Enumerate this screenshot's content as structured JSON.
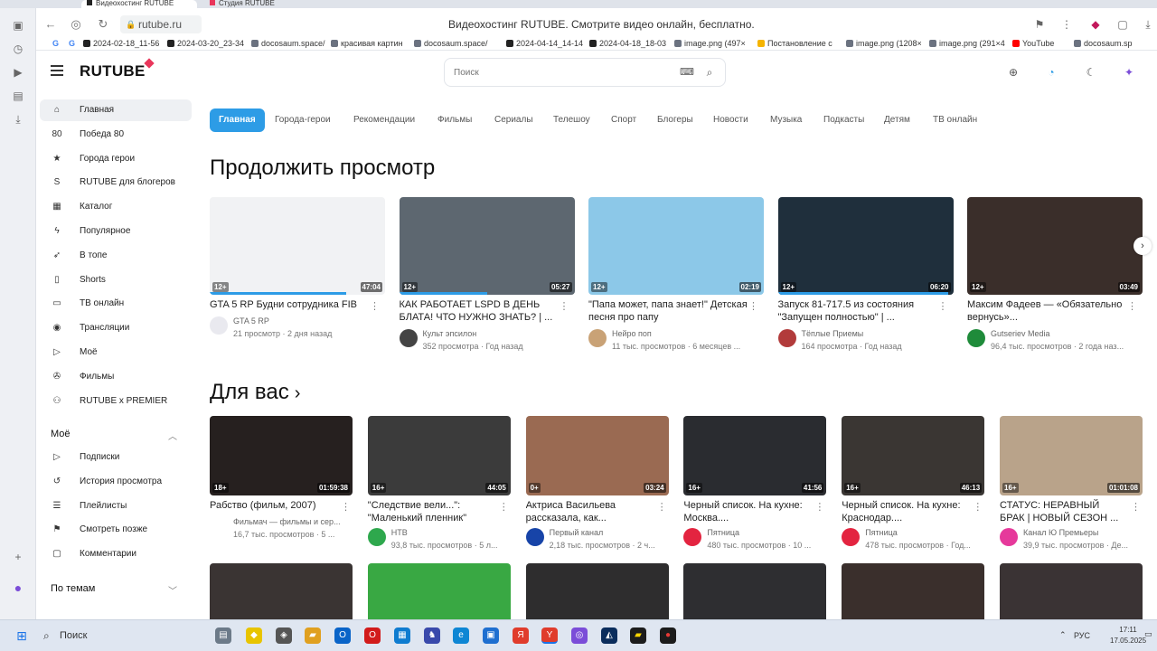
{
  "browser": {
    "tabs": [
      {
        "label": "Видеохостинг RUTUBE",
        "active": true
      },
      {
        "label": "Студия RUTUBE",
        "active": false
      }
    ],
    "url": "rutube.ru",
    "page_title": "Видеохостинг RUTUBE. Смотрите видео онлайн, бесплатно.",
    "bookmarks": [
      {
        "label": "2024-02-18_11-56",
        "color": "#222222"
      },
      {
        "label": "2024-03-20_23-34",
        "color": "#222222"
      },
      {
        "label": "docosaum.space/",
        "color": "#6b7280"
      },
      {
        "label": "красивая картин",
        "color": "#6b7280"
      },
      {
        "label": "docosaum.space/",
        "color": "#6b7280"
      },
      {
        "label": "2024-04-14_14-14",
        "color": "#222222"
      },
      {
        "label": "2024-04-18_18-03",
        "color": "#222222"
      },
      {
        "label": "image.png (497×",
        "color": "#6b7280"
      },
      {
        "label": "Постановление с",
        "color": "#f5b400"
      },
      {
        "label": "image.png (1208×",
        "color": "#6b7280"
      },
      {
        "label": "image.png (291×4",
        "color": "#6b7280"
      },
      {
        "label": "YouTube",
        "color": "#ff0000"
      },
      {
        "label": "docosaum.sp",
        "color": "#6b7280"
      }
    ]
  },
  "header": {
    "logo": "RUTUBE",
    "search_placeholder": "Поиск"
  },
  "sidebar": {
    "items": [
      {
        "label": "Главная",
        "icon": "home-icon",
        "glyph": "⌂",
        "active": true
      },
      {
        "label": "Победа 80",
        "icon": "victory-80-icon",
        "glyph": "80",
        "active": false
      },
      {
        "label": "Города герои",
        "icon": "star-icon",
        "glyph": "★",
        "active": false
      },
      {
        "label": "RUTUBE для блогеров",
        "icon": "rutube-s-icon",
        "glyph": "S",
        "active": false
      },
      {
        "label": "Каталог",
        "icon": "grid-icon",
        "glyph": "▦",
        "active": false
      },
      {
        "label": "Популярное",
        "icon": "lightning-icon",
        "glyph": "ϟ",
        "active": false
      },
      {
        "label": "В топе",
        "icon": "rocket-icon",
        "glyph": "➶",
        "active": false
      },
      {
        "label": "Shorts",
        "icon": "shorts-icon",
        "glyph": "▯",
        "active": false
      },
      {
        "label": "ТВ онлайн",
        "icon": "tv-icon",
        "glyph": "▭",
        "active": false
      },
      {
        "label": "Трансляции",
        "icon": "broadcast-icon",
        "glyph": "◉",
        "active": false
      },
      {
        "label": "Моё",
        "icon": "my-icon",
        "glyph": "▷",
        "active": false
      },
      {
        "label": "Фильмы",
        "icon": "film-reel-icon",
        "glyph": "✇",
        "active": false
      },
      {
        "label": "RUTUBE x PREMIER",
        "icon": "premier-icon",
        "glyph": "⚇",
        "active": false
      }
    ],
    "my_section": {
      "title": "Моё",
      "items": [
        {
          "label": "Подписки",
          "icon": "subscriptions-icon",
          "glyph": "▷"
        },
        {
          "label": "История просмотра",
          "icon": "history-icon",
          "glyph": "↺"
        },
        {
          "label": "Плейлисты",
          "icon": "playlist-icon",
          "glyph": "☰"
        },
        {
          "label": "Смотреть позже",
          "icon": "bookmark-icon",
          "glyph": "⚑"
        },
        {
          "label": "Комментарии",
          "icon": "comment-icon",
          "glyph": "▢"
        }
      ]
    },
    "topics_section": {
      "title": "По темам"
    }
  },
  "categories": [
    "Главная",
    "Города-герои",
    "Рекомендации",
    "Фильмы",
    "Сериалы",
    "Телешоу",
    "Спорт",
    "Блогеры",
    "Новости",
    "Музыка",
    "Подкасты",
    "Детям",
    "ТВ онлайн"
  ],
  "continue_section": {
    "title": "Продолжить просмотр",
    "videos": [
      {
        "title": "GTA 5 RP Будни сотрудника FIB",
        "channel": "GTA 5 RP",
        "views": "21 просмотр",
        "age": "2 дня назад",
        "rating": "12+",
        "duration": "47:04",
        "progress": 0.78,
        "thumb_color": "#f1f2f4",
        "avatar_color": "#e9e9ef"
      },
      {
        "title": "КАК РАБОТАЕТ LSPD В ДЕНЬ БЛАТА! ЧТО НУЖНО ЗНАТЬ? | ...",
        "channel": "Культ эпсилон",
        "views": "352 просмотра",
        "age": "Год назад",
        "rating": "12+",
        "duration": "05:27",
        "progress": 0.5,
        "thumb_color": "#5d6770",
        "avatar_color": "#444444"
      },
      {
        "title": "\"Папа может, папа знает!\" Детская песня про папу",
        "channel": "Нейро поп",
        "views": "11 тыс. просмотров",
        "age": "6 месяцев ...",
        "rating": "12+",
        "duration": "02:19",
        "progress": 0,
        "thumb_color": "#8cc8e8",
        "avatar_color": "#c9a276"
      },
      {
        "title": "Запуск 81-717.5 из состояния \"Запущен полностью\" | ...",
        "channel": "Тёплые Приемы",
        "views": "164 просмотра",
        "age": "Год назад",
        "rating": "12+",
        "duration": "06:20",
        "progress": 0.97,
        "thumb_color": "#1f2f3c",
        "avatar_color": "#b23b3b"
      },
      {
        "title": "Максим Фадеев — «Обязательно вернусь»...",
        "channel": "Gutseriev Media",
        "views": "96,4 тыс. просмотров",
        "age": "2 года наз...",
        "rating": "12+",
        "duration": "03:49",
        "progress": 0,
        "thumb_color": "#3a2e2a",
        "avatar_color": "#1f8b3a"
      }
    ]
  },
  "for_you_section": {
    "title": "Для вас",
    "videos": [
      {
        "title": "Рабство (фильм, 2007)",
        "channel": "Фильмач — фильмы и сер...",
        "views": "16,7 тыс. просмотров",
        "age": "5 ...",
        "rating": "18+",
        "duration": "01:59:38",
        "thumb_color": "#26201f",
        "avatar_color": "#ffffff"
      },
      {
        "title": "\"Следствие вели...\": \"Маленький пленник\"",
        "channel": "НТВ",
        "views": "93,8 тыс. просмотров",
        "age": "5 л...",
        "rating": "16+",
        "duration": "44:05",
        "thumb_color": "#3b3b3b",
        "avatar_color": "#2ea84d"
      },
      {
        "title": "Актриса Васильева рассказала, как...",
        "channel": "Первый канал",
        "views": "2,18 тыс. просмотров",
        "age": "2 ч...",
        "rating": "0+",
        "duration": "03:24",
        "thumb_color": "#9a6a52",
        "avatar_color": "#1744a8"
      },
      {
        "title": "Черный список. На кухне: Москва....",
        "channel": "Пятница",
        "views": "480 тыс. просмотров",
        "age": "10 ...",
        "rating": "16+",
        "duration": "41:56",
        "thumb_color": "#2a2c30",
        "avatar_color": "#e32440"
      },
      {
        "title": "Черный список. На кухне: Краснодар....",
        "channel": "Пятница",
        "views": "478 тыс. просмотров",
        "age": "Год...",
        "rating": "16+",
        "duration": "46:13",
        "thumb_color": "#3a3633",
        "avatar_color": "#e32440"
      },
      {
        "title": "СТАТУС: НЕРАВНЫЙ БРАК | НОВЫЙ СЕЗОН ...",
        "channel": "Канал Ю Премьеры",
        "views": "39,9 тыс. просмотров",
        "age": "Де...",
        "rating": "16+",
        "duration": "01:01:08",
        "thumb_color": "#b9a38a",
        "avatar_color": "#e6399b"
      }
    ],
    "row2_colors": [
      "#3a3433",
      "#39a843",
      "#2e2d2e",
      "#2e2e31",
      "#3a2f2c",
      "#3a3334"
    ]
  },
  "taskbar": {
    "search_label": "Поиск",
    "language": "РУС",
    "time": "17:11",
    "date": "17.05.2025"
  }
}
